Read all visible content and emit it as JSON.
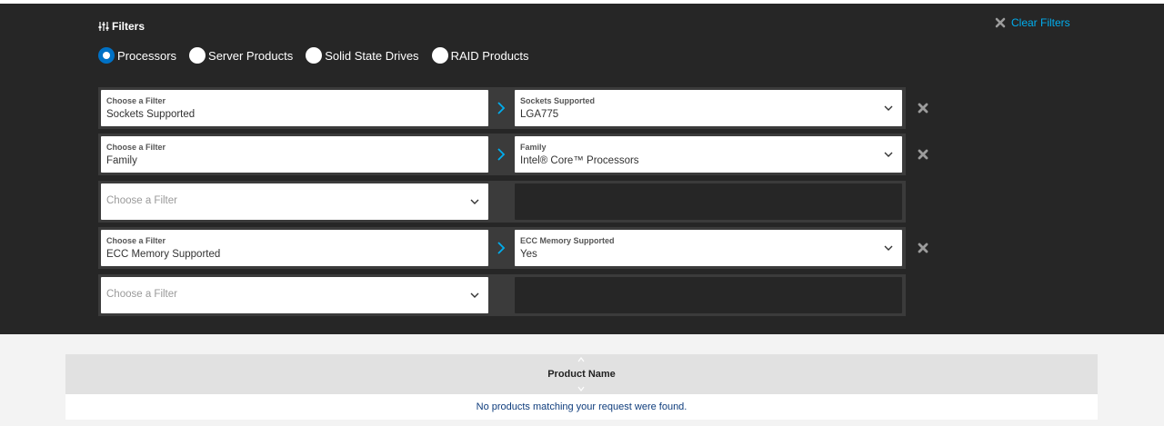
{
  "filters": {
    "title": "Filters",
    "clear_label": "Clear Filters",
    "categories": [
      {
        "label": "Processors",
        "selected": true
      },
      {
        "label": "Server Products",
        "selected": false
      },
      {
        "label": "Solid State Drives",
        "selected": false
      },
      {
        "label": "RAID Products",
        "selected": false
      }
    ],
    "rows": [
      {
        "filter_label": "Choose a Filter",
        "filter_value": "Sockets Supported",
        "value_label": "Sockets Supported",
        "value": "LGA775"
      },
      {
        "filter_label": "Choose a Filter",
        "filter_value": "Family",
        "value_label": "Family",
        "value": "Intel® Core™ Processors"
      },
      {
        "placeholder": "Choose a Filter"
      },
      {
        "filter_label": "Choose a Filter",
        "filter_value": "ECC Memory Supported",
        "value_label": "ECC Memory Supported",
        "value": "Yes"
      },
      {
        "placeholder": "Choose a Filter"
      }
    ]
  },
  "results": {
    "column_header": "Product Name",
    "empty_message": "No products matching your request were found."
  },
  "colors": {
    "panel_bg": "#262626",
    "accent": "#0071c5",
    "link": "#00aeef"
  }
}
